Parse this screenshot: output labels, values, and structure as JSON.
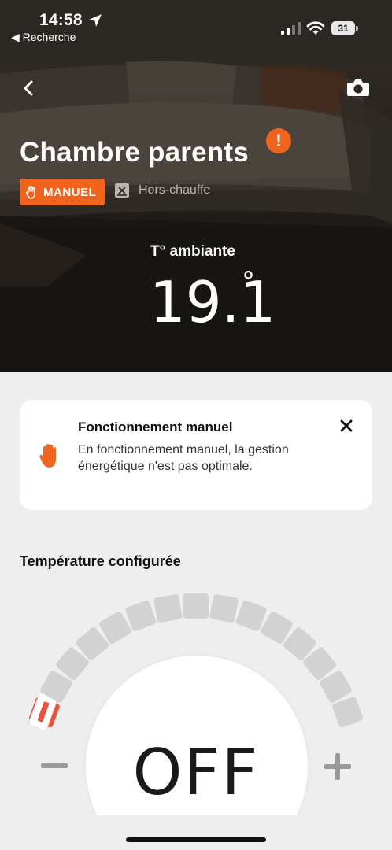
{
  "status_bar": {
    "time": "14:58",
    "back_app_label": "◀ Recherche",
    "battery_level": "31",
    "icons": [
      "location-arrow-icon",
      "signal-icon",
      "wifi-icon",
      "battery-icon"
    ]
  },
  "hero": {
    "room_name": "Chambre parents",
    "alert_symbol": "!",
    "mode_label": "MANUEL",
    "state_label": "Hors-chauffe",
    "ambient_label": "T° ambiante",
    "ambient_value": "19.1",
    "degree_symbol": "°"
  },
  "info_card": {
    "title": "Fonctionnement manuel",
    "text": "En fonctionnement manuel, la gestion énergétique n'est pas optimale."
  },
  "config": {
    "title": "Température configurée",
    "setpoint_label": "OFF",
    "dial_segment_count": 15,
    "active_segment_index": 0
  },
  "colors": {
    "accent": "#f0641e",
    "active_segment": "#e8533a",
    "inactive_segment": "#d2d2d2",
    "background": "#eeeeee"
  }
}
